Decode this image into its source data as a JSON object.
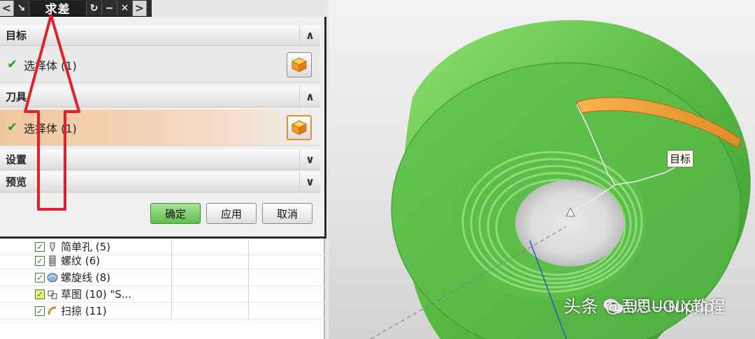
{
  "dialog": {
    "title": "求差",
    "title_buttons": {
      "left_nav": "<",
      "pin": "↘",
      "reset": "↻",
      "minimize": "−",
      "close": "✕",
      "right_nav": ">"
    },
    "sections": {
      "target": {
        "header": "目标",
        "select_label": "选择体 (1)",
        "chevron": "∧"
      },
      "tool": {
        "header": "刀具",
        "select_label": "选择体 (1)",
        "chevron": "∧"
      },
      "settings": {
        "header": "设置",
        "chevron": "∨"
      },
      "preview": {
        "header": "预览",
        "chevron": "∨"
      }
    },
    "buttons": {
      "ok": "确定",
      "apply": "应用",
      "cancel": "取消"
    }
  },
  "tree": {
    "rows": [
      {
        "label": "简单孔 (5)",
        "icon": "hole-icon"
      },
      {
        "label": "螺纹 (6)",
        "icon": "thread-icon"
      },
      {
        "label": "螺旋线 (8)",
        "icon": "helix-icon"
      },
      {
        "label": "草图 (10) \"S...",
        "icon": "sketch-icon"
      },
      {
        "label": "扫掠 (11)",
        "icon": "sweep-icon"
      }
    ]
  },
  "viewport": {
    "tooltip": "目标",
    "body_color": "#6fcf5a",
    "tool_color": "#f0a040"
  },
  "watermark": {
    "source": "头条",
    "author": "@吾思UGupup",
    "channel": "UG—NX教程"
  },
  "colors": {
    "annotation_arrow": "#e0202a",
    "ok_button": "#6cc35a"
  }
}
